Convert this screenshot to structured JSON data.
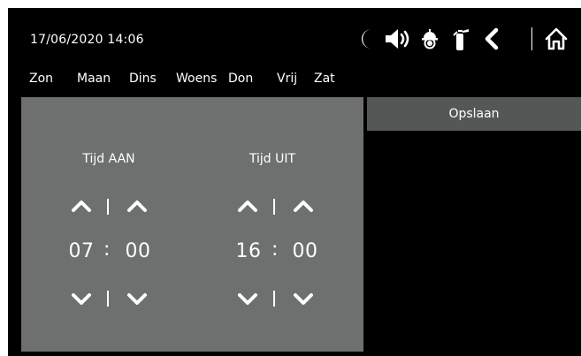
{
  "header": {
    "datetime": "17/06/2020 14:06",
    "days": [
      "Zon",
      "Maan",
      "Dins",
      "Woens",
      "Don",
      "Vrij",
      "Zat"
    ],
    "icons": [
      "moon-icon",
      "speaker-icon",
      "helmet-icon",
      "fire-extinguisher-icon",
      "back-icon",
      "home-icon"
    ]
  },
  "time_panel": {
    "on": {
      "title": "Tijd AAN",
      "hours": "07",
      "minutes": "00"
    },
    "off": {
      "title": "Tijd UIT",
      "hours": "16",
      "minutes": "00"
    },
    "colon": ":"
  },
  "actions": {
    "save_label": "Opslaan"
  },
  "colors": {
    "panel": "#6d706f",
    "save_button": "#555757",
    "background": "#000000"
  }
}
